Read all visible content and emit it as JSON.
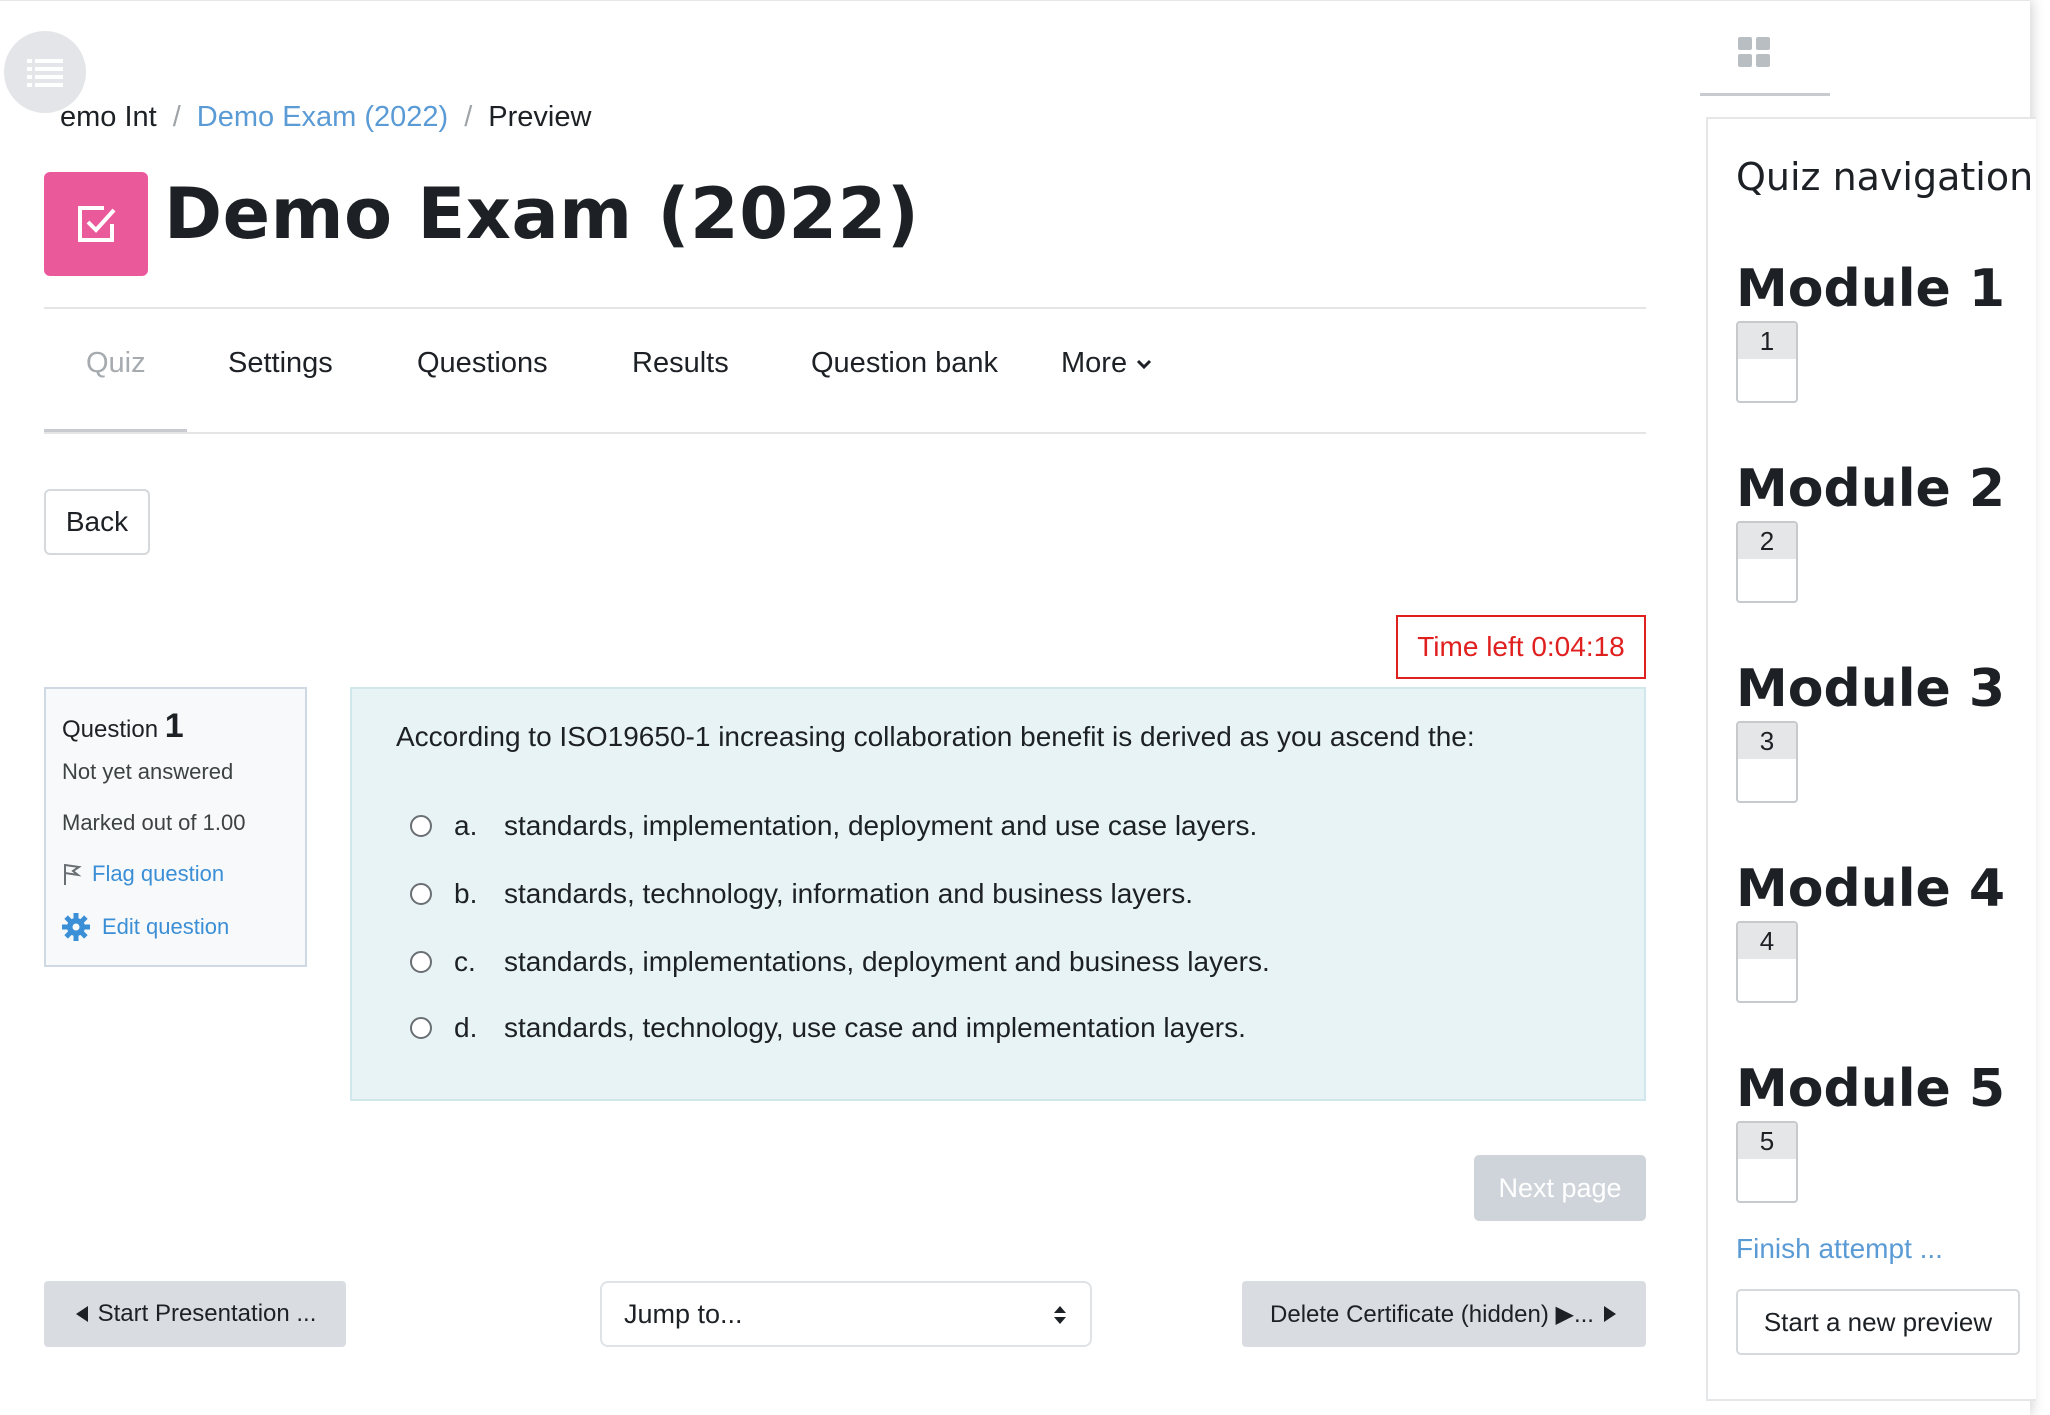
{
  "breadcrumb": {
    "item1": "emo Int",
    "item2": "Demo Exam (2022)",
    "item3": "Preview",
    "separator": "/"
  },
  "page_title": "Demo Exam (2022)",
  "tabs": [
    {
      "label": "Quiz",
      "active": true
    },
    {
      "label": "Settings"
    },
    {
      "label": "Questions"
    },
    {
      "label": "Results"
    },
    {
      "label": "Question bank"
    },
    {
      "label": "More"
    }
  ],
  "back_label": "Back",
  "timer": {
    "text": "Time left 0:04:18"
  },
  "question_info": {
    "label": "Question",
    "number": "1",
    "status": "Not yet answered",
    "marked": "Marked out of 1.00",
    "flag": "Flag question",
    "edit": "Edit question"
  },
  "question": {
    "text": "According to ISO19650-1 increasing collaboration benefit is derived as you ascend the:",
    "answers": [
      {
        "letter": "a.",
        "text": "standards, implementation, deployment and use case layers."
      },
      {
        "letter": "b.",
        "text": "standards, technology, information and business layers."
      },
      {
        "letter": "c.",
        "text": "standards, implementations, deployment and business layers."
      },
      {
        "letter": "d.",
        "text": "standards, technology, use case and implementation layers."
      }
    ]
  },
  "next_page": "Next page",
  "prev_activity": "Start Presentation ...",
  "jump_to": "Jump to...",
  "next_activity": "Delete Certificate (hidden) ▶...",
  "quiz_nav": {
    "title": "Quiz navigation",
    "modules": [
      {
        "title": "Module 1",
        "q": "1"
      },
      {
        "title": "Module 2",
        "q": "2"
      },
      {
        "title": "Module 3",
        "q": "3"
      },
      {
        "title": "Module 4",
        "q": "4"
      },
      {
        "title": "Module 5",
        "q": "5"
      }
    ],
    "finish": "Finish attempt ...",
    "new_preview": "Start a new preview"
  },
  "colors": {
    "brand_pink": "#ea5a9a",
    "link_blue": "#5b9bd5",
    "timer_red": "#e0201f",
    "question_bg": "#e7f3f5"
  }
}
